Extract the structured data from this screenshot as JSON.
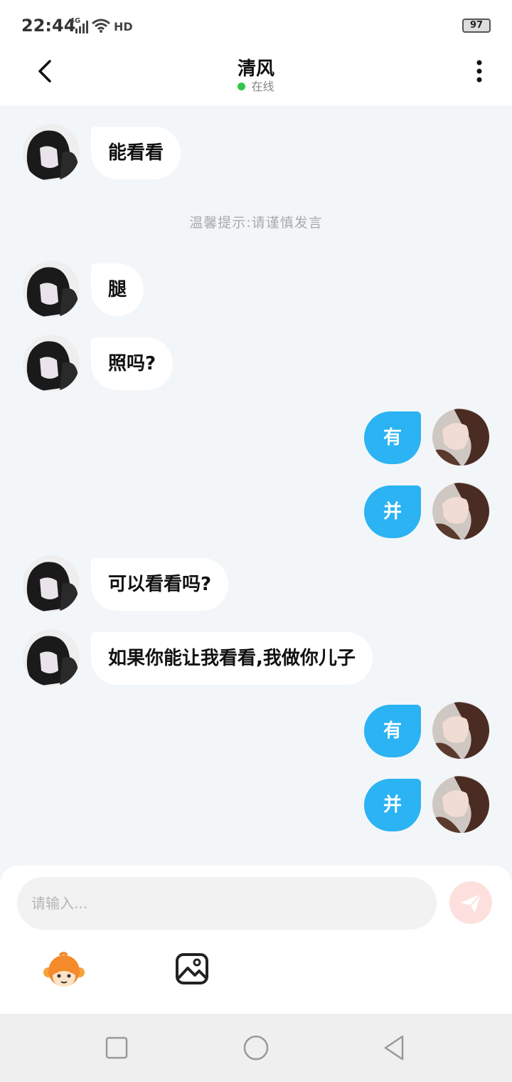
{
  "status_bar": {
    "time": "22:44",
    "network": "4G",
    "hd": "HD",
    "battery": "97"
  },
  "header": {
    "title": "清风",
    "status": "在线",
    "status_color": "#2fc84a"
  },
  "messages": [
    {
      "side": "in",
      "text": "能看看"
    },
    {
      "side": "tip",
      "text": "温馨提示:请谨慎发言"
    },
    {
      "side": "in",
      "text": "腿"
    },
    {
      "side": "in",
      "text": "照吗?"
    },
    {
      "side": "out",
      "text": "有"
    },
    {
      "side": "out",
      "text": "并"
    },
    {
      "side": "in",
      "text": "可以看看吗?"
    },
    {
      "side": "in",
      "text": "如果你能让我看看,我做你儿子"
    },
    {
      "side": "out",
      "text": "有"
    },
    {
      "side": "out",
      "text": "并"
    }
  ],
  "composer": {
    "placeholder": "请输入...",
    "value": ""
  },
  "colors": {
    "outgoing_bubble": "#2bb3f3",
    "incoming_bubble": "#ffffff",
    "send_button": "#fde0dd"
  },
  "icons": {
    "back": "chevron-left-icon",
    "more": "more-vertical-icon",
    "send": "paper-plane-icon",
    "emoji": "monkey-emoji-icon",
    "image": "image-icon"
  }
}
